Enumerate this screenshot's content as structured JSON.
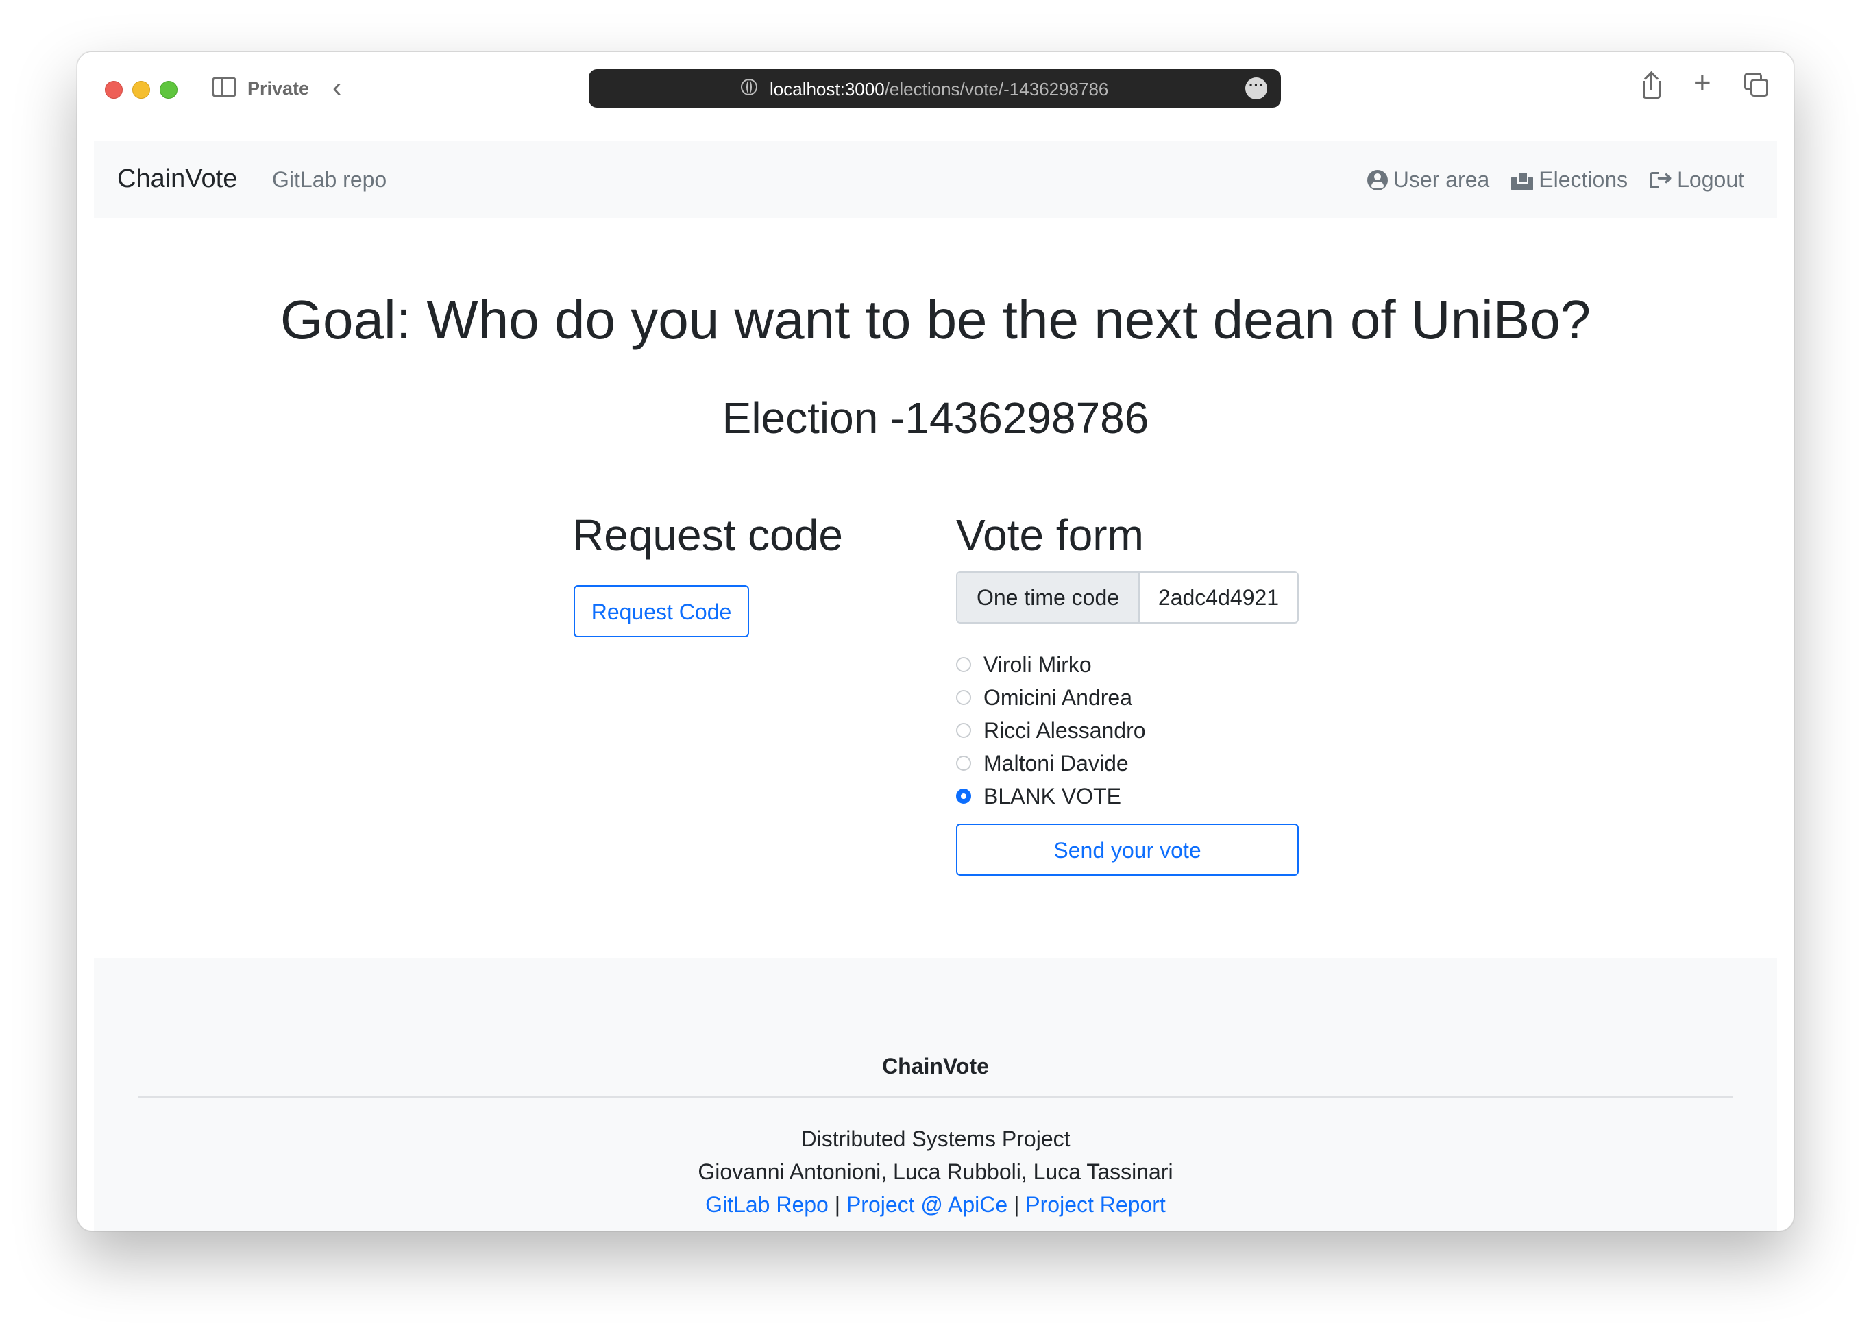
{
  "browser": {
    "private_label": "Private",
    "url_host": "localhost:3000",
    "url_path": "/elections/vote/-1436298786"
  },
  "navbar": {
    "brand": "ChainVote",
    "gitlab_link": "GitLab repo",
    "user_area": "User area",
    "elections": "Elections",
    "logout": "Logout"
  },
  "main": {
    "goal_title": "Goal: Who do you want to be the next dean of UniBo?",
    "election_title": "Election -1436298786",
    "request_heading": "Request code",
    "request_button": "Request Code",
    "vote_heading": "Vote form",
    "code_label": "One time code",
    "code_value": "2adc4d4921",
    "options": [
      {
        "label": "Viroli Mirko",
        "checked": false
      },
      {
        "label": "Omicini Andrea",
        "checked": false
      },
      {
        "label": "Ricci Alessandro",
        "checked": false
      },
      {
        "label": "Maltoni Davide",
        "checked": false
      },
      {
        "label": "BLANK VOTE",
        "checked": true
      }
    ],
    "send_button": "Send your vote"
  },
  "footer": {
    "brand": "ChainVote",
    "line1": "Distributed Systems Project",
    "line2": "Giovanni Antonioni, Luca Rubboli, Luca Tassinari",
    "links": [
      "GitLab Repo",
      "Project @ ApiCe",
      "Project Report"
    ],
    "separator": "|"
  },
  "colors": {
    "primary": "#0d6efd",
    "navbar_bg": "#f8f9fa",
    "text": "#212529",
    "muted": "#6c757d"
  }
}
